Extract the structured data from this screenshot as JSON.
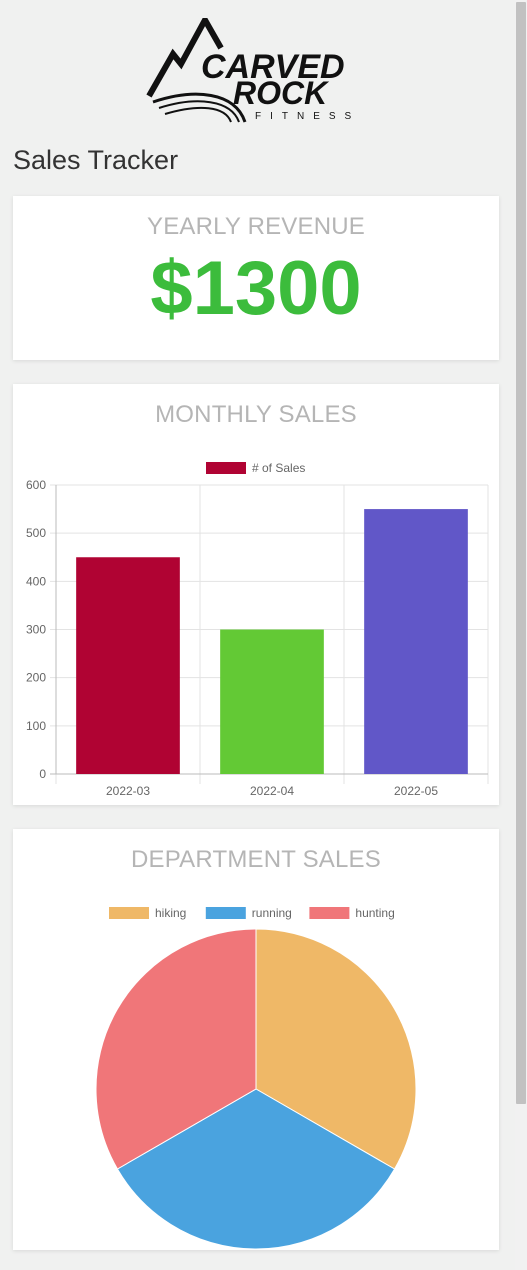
{
  "brand": {
    "logo_text_line1": "CARVED",
    "logo_text_line2": "ROCK",
    "logo_text_line3": "FITNESS"
  },
  "page": {
    "title": "Sales Tracker"
  },
  "revenue": {
    "title": "YEARLY REVENUE",
    "value": "$1300",
    "color": "#3cbc3c"
  },
  "monthly": {
    "title": "MONTHLY SALES"
  },
  "department": {
    "title": "DEPARTMENT SALES"
  },
  "chart_data": [
    {
      "type": "bar",
      "title": "",
      "legend": {
        "position": "top",
        "label": "# of Sales"
      },
      "categories": [
        "2022-03",
        "2022-04",
        "2022-05"
      ],
      "series": [
        {
          "name": "# of Sales",
          "values": [
            450,
            300,
            550
          ]
        }
      ],
      "colors": [
        "#b00333",
        "#63c935",
        "#6157c8"
      ],
      "ylim": [
        0,
        600
      ],
      "yticks": [
        "0",
        "100",
        "200",
        "300",
        "400",
        "500",
        "600"
      ],
      "grid": true
    },
    {
      "type": "pie",
      "title": "",
      "legend": {
        "position": "top"
      },
      "labels": [
        "hiking",
        "running",
        "hunting"
      ],
      "values": [
        1,
        1,
        1
      ],
      "colors": [
        "#efb867",
        "#4aa3df",
        "#f07679"
      ]
    }
  ]
}
